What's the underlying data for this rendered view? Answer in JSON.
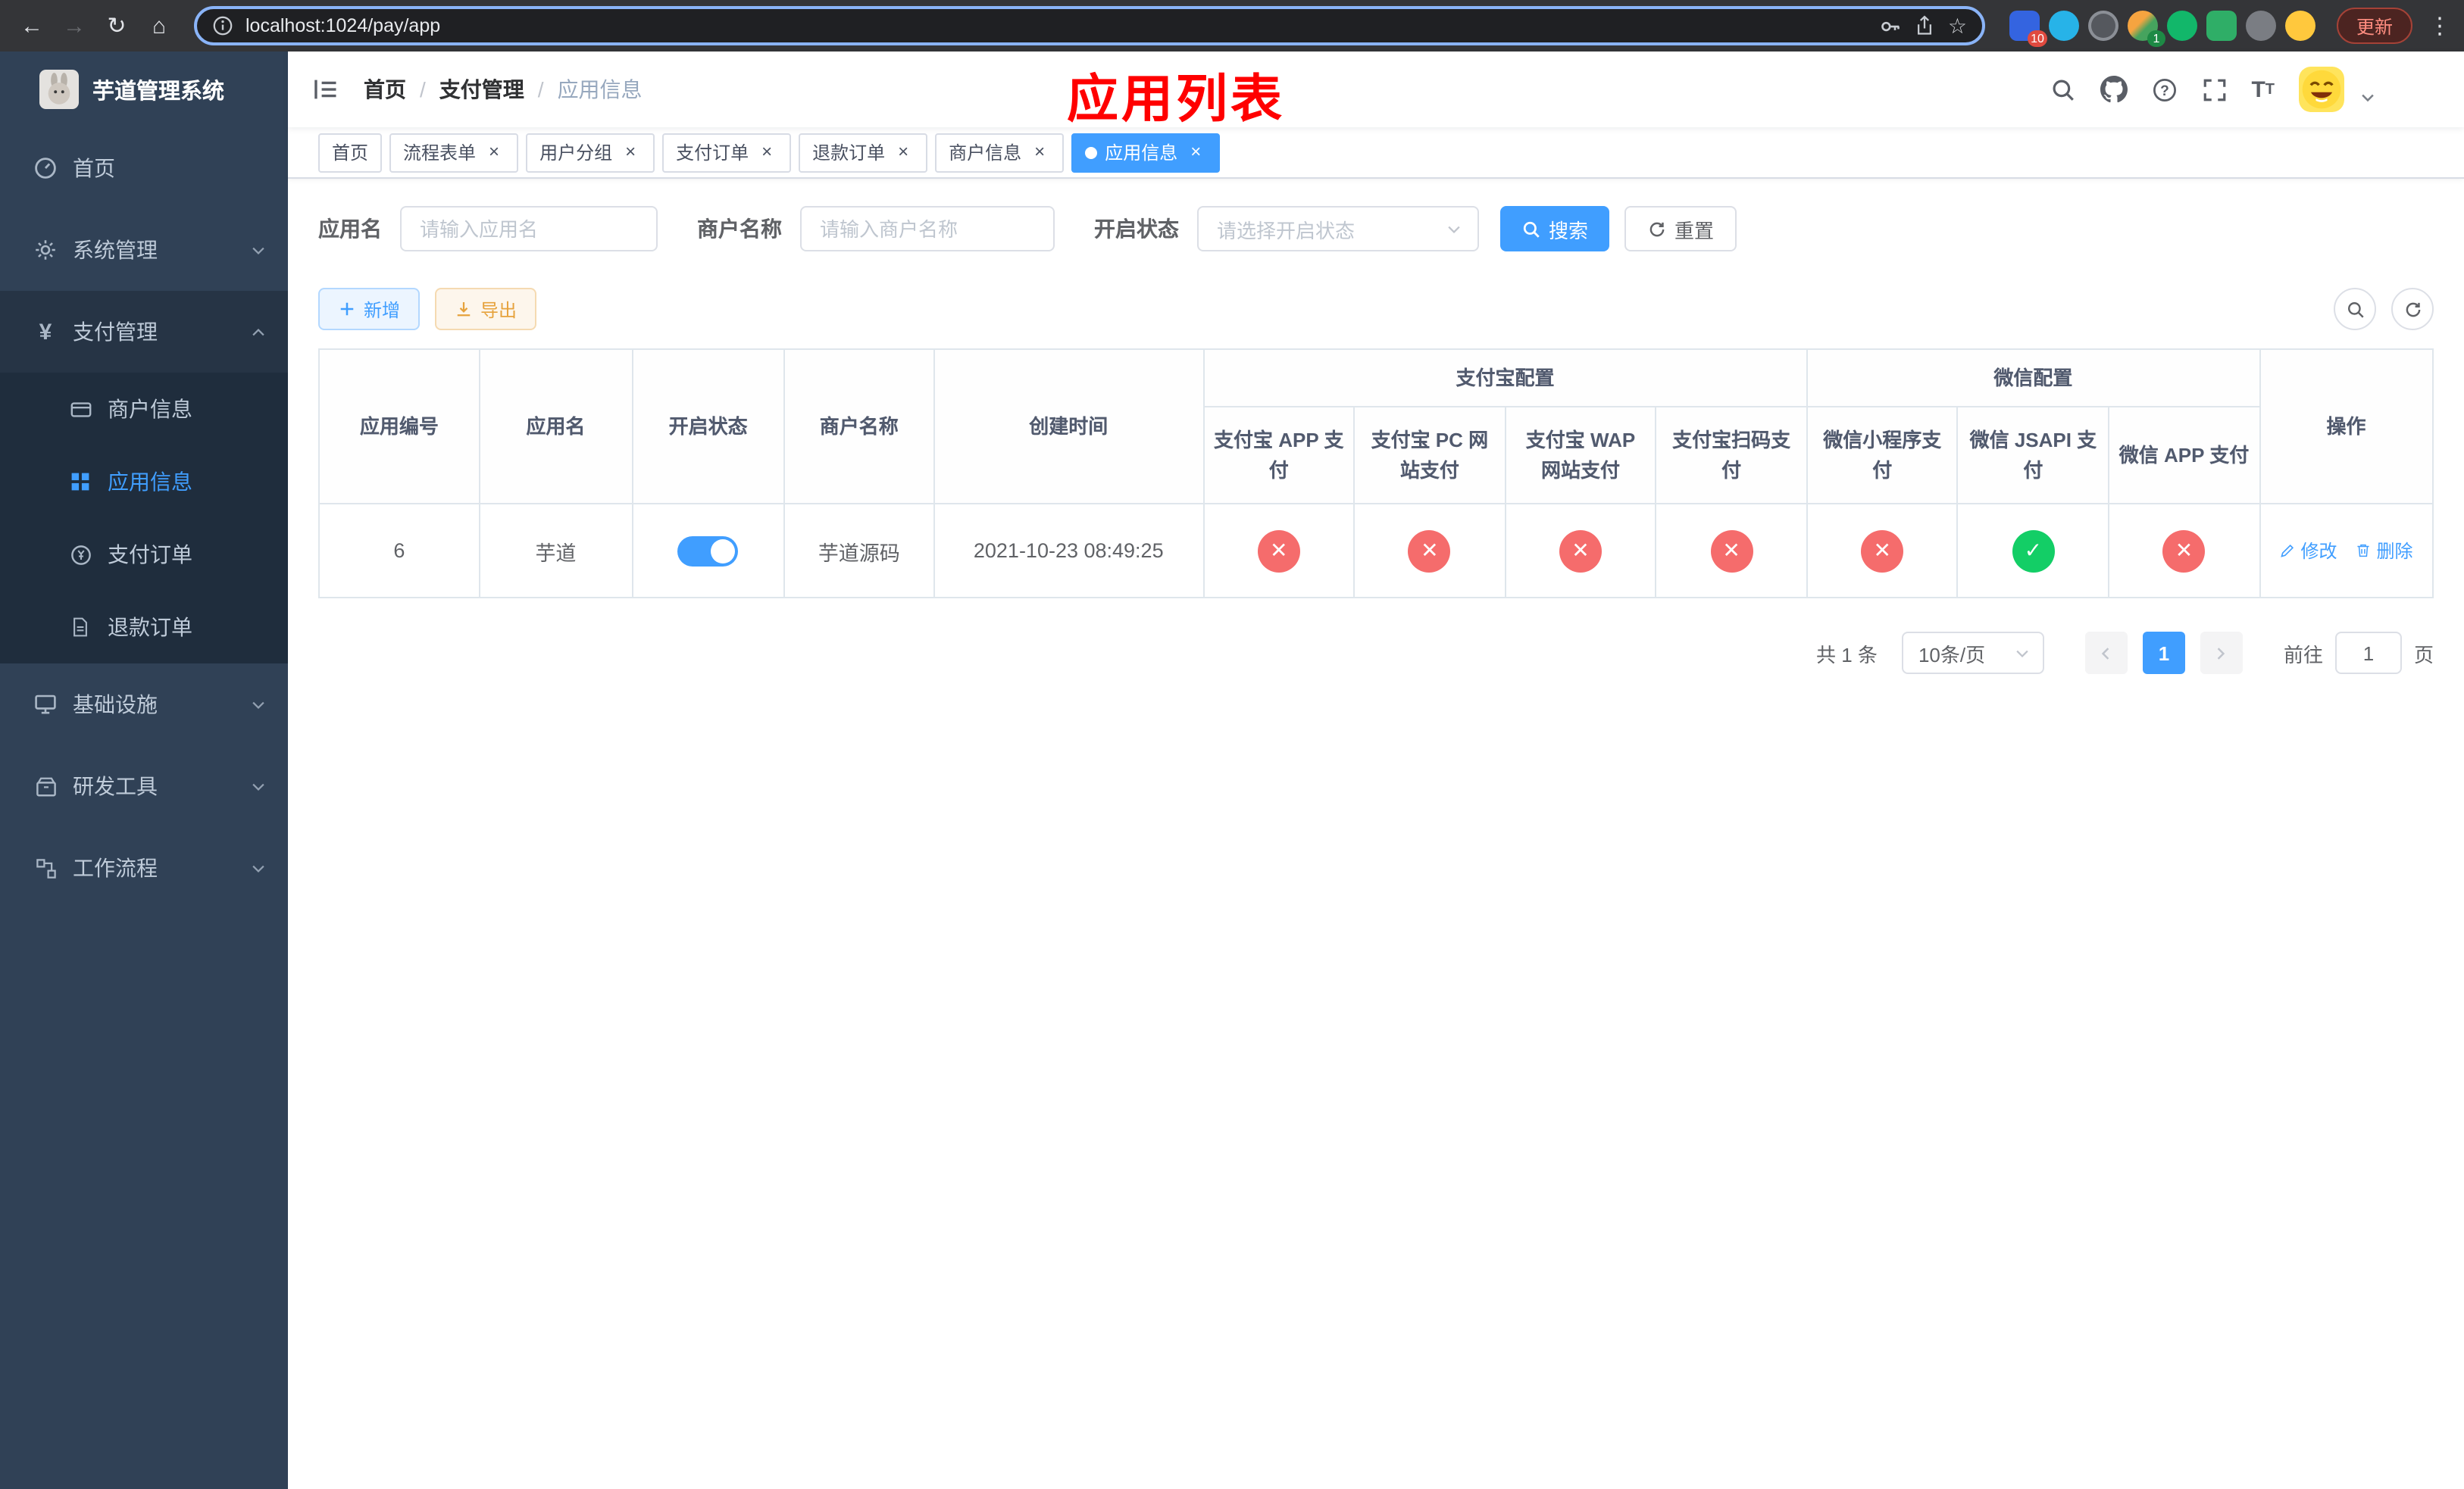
{
  "browser": {
    "url": "localhost:1024/pay/app",
    "update_label": "更新",
    "extension_badges": {
      "first": "10",
      "fourth": "1"
    }
  },
  "sidebar": {
    "title": "芋道管理系统",
    "items": [
      {
        "label": "首页"
      },
      {
        "label": "系统管理"
      },
      {
        "label": "支付管理",
        "children": [
          {
            "label": "商户信息"
          },
          {
            "label": "应用信息"
          },
          {
            "label": "支付订单"
          },
          {
            "label": "退款订单"
          }
        ]
      },
      {
        "label": "基础设施"
      },
      {
        "label": "研发工具"
      },
      {
        "label": "工作流程"
      }
    ]
  },
  "header": {
    "breadcrumb": [
      "首页",
      "支付管理",
      "应用信息"
    ],
    "separator": "/",
    "annotation": "应用列表"
  },
  "tabs": [
    {
      "label": "首页"
    },
    {
      "label": "流程表单"
    },
    {
      "label": "用户分组"
    },
    {
      "label": "支付订单"
    },
    {
      "label": "退款订单"
    },
    {
      "label": "商户信息"
    },
    {
      "label": "应用信息"
    }
  ],
  "filters": {
    "app_name_label": "应用名",
    "app_name_placeholder": "请输入应用名",
    "merchant_label": "商户名称",
    "merchant_placeholder": "请输入商户名称",
    "status_label": "开启状态",
    "status_placeholder": "请选择开启状态",
    "search_label": "搜索",
    "reset_label": "重置"
  },
  "toolbar": {
    "add_label": "新增",
    "export_label": "导出"
  },
  "table": {
    "groups": [
      {
        "label": "支付宝配置",
        "span": 4
      },
      {
        "label": "微信配置",
        "span": 3
      }
    ],
    "columns": [
      "应用编号",
      "应用名",
      "开启状态",
      "商户名称",
      "创建时间",
      "支付宝 APP 支付",
      "支付宝 PC 网站支付",
      "支付宝 WAP 网站支付",
      "支付宝扫码支付",
      "微信小程序支付",
      "微信 JSAPI 支付",
      "微信 APP 支付",
      "操作"
    ],
    "rows": [
      {
        "id": "6",
        "name": "芋道",
        "enabled": true,
        "merchant": "芋道源码",
        "created_at": "2021-10-23 08:49:25",
        "configs": [
          false,
          false,
          false,
          false,
          false,
          true,
          false
        ],
        "actions": [
          "修改",
          "删除"
        ]
      }
    ]
  },
  "pagination": {
    "total": "共 1 条",
    "page_size": "10条/页",
    "current_page": "1",
    "goto_label": "前往",
    "goto_value": "1",
    "goto_unit": "页"
  },
  "icons": {
    "yes_glyph": "✓",
    "no_glyph": "✕",
    "close_glyph": "×"
  },
  "colors": {
    "primary": "#409eff",
    "success": "#13ce66",
    "danger": "#f56c6c",
    "sidebar_bg": "#304156",
    "annotation": "#ff0000"
  }
}
